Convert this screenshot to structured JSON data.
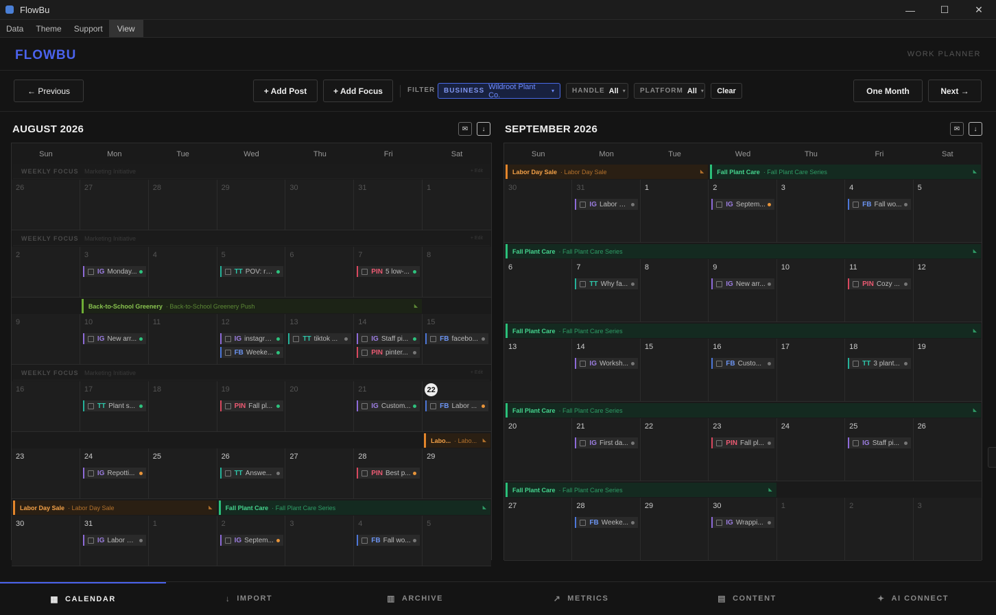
{
  "app": {
    "title": "FlowBu",
    "logo": "FLOWBU",
    "planner": "WORK PLANNER"
  },
  "window": {
    "minimize": "—",
    "maximize": "☐",
    "close": "✕"
  },
  "menu": [
    "Data",
    "Theme",
    "Support",
    "View"
  ],
  "toolbar": {
    "previous": "← Previous",
    "add_post": "+ Add Post",
    "add_focus": "+ Add Focus",
    "filter": "FILTER",
    "business_label": "BUSINESS",
    "business_value": "Wildroot Plant Co.",
    "handle_label": "HANDLE",
    "handle_value": "All",
    "platform_label": "PLATFORM",
    "platform_value": "All",
    "clear": "Clear",
    "one_month": "One Month",
    "next": "Next →"
  },
  "dow": [
    "Sun",
    "Mon",
    "Tue",
    "Wed",
    "Thu",
    "Fri",
    "Sat"
  ],
  "nav": [
    {
      "icon": "▦",
      "label": "CALENDAR"
    },
    {
      "icon": "↓",
      "label": "IMPORT"
    },
    {
      "icon": "▥",
      "label": "ARCHIVE"
    },
    {
      "icon": "↗",
      "label": "METRICS"
    },
    {
      "icon": "▤",
      "label": "CONTENT"
    },
    {
      "icon": "✦",
      "label": "AI CONNECT"
    }
  ],
  "colors": {
    "accent": "#4b63ee",
    "ig": "#8e6bd9",
    "tt": "#25b29a",
    "pin": "#d9485f",
    "fb": "#4d77d9"
  },
  "months": [
    {
      "title": "AUGUST 2026",
      "weeks": [
        {
          "focus": {
            "label": "WEEKLY FOCUS",
            "sub": "Marketing Initiative",
            "edit": "+ Edit"
          },
          "days": [
            {
              "n": "26",
              "out": true
            },
            {
              "n": "27",
              "out": true
            },
            {
              "n": "28",
              "out": true
            },
            {
              "n": "29",
              "out": true
            },
            {
              "n": "30",
              "out": true
            },
            {
              "n": "31",
              "out": true
            },
            {
              "n": "1",
              "out": true
            }
          ]
        },
        {
          "focus": {
            "label": "WEEKLY FOCUS",
            "sub": "Marketing Initiative",
            "edit": "+ Edit"
          },
          "days": [
            {
              "n": "2",
              "out": true
            },
            {
              "n": "3",
              "out": true,
              "posts": [
                {
                  "p": "IG",
                  "t": "Monday...",
                  "d": "#2ec27e"
                }
              ]
            },
            {
              "n": "4",
              "out": true
            },
            {
              "n": "5",
              "out": true,
              "posts": [
                {
                  "p": "TT",
                  "t": "POV: re...",
                  "d": "#2ec27e"
                }
              ]
            },
            {
              "n": "6",
              "out": true
            },
            {
              "n": "7",
              "out": true,
              "posts": [
                {
                  "p": "PIN",
                  "t": "5 low-...",
                  "d": "#2ec27e"
                }
              ]
            },
            {
              "n": "8",
              "out": true
            }
          ]
        },
        {
          "events": [
            {
              "s": 1,
              "e": 6,
              "c": "L",
              "n": "Back-to-School Greenery",
              "sub": "· Back-to-School Greenery Push"
            }
          ],
          "days": [
            {
              "n": "9",
              "out": true
            },
            {
              "n": "10",
              "out": true,
              "posts": [
                {
                  "p": "IG",
                  "t": "New arr...",
                  "d": "#2ec27e"
                }
              ]
            },
            {
              "n": "11",
              "out": true
            },
            {
              "n": "12",
              "out": true,
              "posts": [
                {
                  "p": "IG",
                  "t": "instagra...",
                  "d": "#2ec27e"
                },
                {
                  "p": "FB",
                  "t": "Weeke...",
                  "d": "#2ec27e"
                }
              ]
            },
            {
              "n": "13",
              "out": true,
              "posts": [
                {
                  "p": "TT",
                  "t": "tiktok ...",
                  "d": "#777"
                }
              ]
            },
            {
              "n": "14",
              "out": true,
              "posts": [
                {
                  "p": "IG",
                  "t": "Staff pi...",
                  "d": "#2ec27e"
                },
                {
                  "p": "PIN",
                  "t": "pinter...",
                  "d": "#777"
                }
              ]
            },
            {
              "n": "15",
              "out": true,
              "posts": [
                {
                  "p": "FB",
                  "t": "facebo...",
                  "d": "#777"
                }
              ]
            }
          ]
        },
        {
          "focus": {
            "label": "WEEKLY FOCUS",
            "sub": "Marketing Initiative",
            "edit": "+ Edit"
          },
          "days": [
            {
              "n": "16",
              "out": true
            },
            {
              "n": "17",
              "out": true,
              "posts": [
                {
                  "p": "TT",
                  "t": "Plant s...",
                  "d": "#2ec27e"
                }
              ]
            },
            {
              "n": "18",
              "out": true
            },
            {
              "n": "19",
              "out": true,
              "posts": [
                {
                  "p": "PIN",
                  "t": "Fall pl...",
                  "d": "#2ec27e"
                }
              ]
            },
            {
              "n": "20",
              "out": true
            },
            {
              "n": "21",
              "out": true,
              "posts": [
                {
                  "p": "IG",
                  "t": "Custom...",
                  "d": "#2ec27e"
                }
              ]
            },
            {
              "n": "22",
              "today": true,
              "posts": [
                {
                  "p": "FB",
                  "t": "Labor ...",
                  "d": "#e8943a"
                }
              ]
            }
          ]
        },
        {
          "events": [
            {
              "s": 6,
              "e": 7,
              "c": "O",
              "n": "Labo...",
              "sub": "· Labo..."
            }
          ],
          "days": [
            {
              "n": "23"
            },
            {
              "n": "24",
              "posts": [
                {
                  "p": "IG",
                  "t": "Repotti...",
                  "d": "#e8943a"
                }
              ]
            },
            {
              "n": "25"
            },
            {
              "n": "26",
              "posts": [
                {
                  "p": "TT",
                  "t": "Answe...",
                  "d": "#777"
                }
              ]
            },
            {
              "n": "27"
            },
            {
              "n": "28",
              "posts": [
                {
                  "p": "PIN",
                  "t": "Best p...",
                  "d": "#e8943a"
                }
              ]
            },
            {
              "n": "29"
            }
          ]
        },
        {
          "events": [
            {
              "s": 0,
              "e": 3,
              "c": "O",
              "n": "Labor Day Sale",
              "sub": "· Labor Day Sale"
            },
            {
              "s": 3,
              "e": 7,
              "c": "G",
              "n": "Fall Plant Care",
              "sub": "· Fall Plant Care Series"
            }
          ],
          "days": [
            {
              "n": "30"
            },
            {
              "n": "31",
              "posts": [
                {
                  "p": "IG",
                  "t": "Labor D...",
                  "d": "#777"
                }
              ]
            },
            {
              "n": "1",
              "out": true
            },
            {
              "n": "2",
              "out": true,
              "posts": [
                {
                  "p": "IG",
                  "t": "Septem...",
                  "d": "#e8943a"
                }
              ]
            },
            {
              "n": "3",
              "out": true
            },
            {
              "n": "4",
              "out": true,
              "posts": [
                {
                  "p": "FB",
                  "t": "Fall wo...",
                  "d": "#777"
                }
              ]
            },
            {
              "n": "5",
              "out": true
            }
          ]
        }
      ]
    },
    {
      "title": "SEPTEMBER 2026",
      "weeks": [
        {
          "events": [
            {
              "s": 0,
              "e": 3,
              "c": "O",
              "n": "Labor Day Sale",
              "sub": "· Labor Day Sale"
            },
            {
              "s": 3,
              "e": 7,
              "c": "G",
              "n": "Fall Plant Care",
              "sub": "· Fall Plant Care Series"
            }
          ],
          "days": [
            {
              "n": "30",
              "out": true
            },
            {
              "n": "31",
              "out": true,
              "posts": [
                {
                  "p": "IG",
                  "t": "Labor D...",
                  "d": "#777"
                }
              ]
            },
            {
              "n": "1"
            },
            {
              "n": "2",
              "posts": [
                {
                  "p": "IG",
                  "t": "Septem...",
                  "d": "#e8943a"
                }
              ]
            },
            {
              "n": "3"
            },
            {
              "n": "4",
              "posts": [
                {
                  "p": "FB",
                  "t": "Fall wo...",
                  "d": "#777"
                }
              ]
            },
            {
              "n": "5"
            }
          ]
        },
        {
          "events": [
            {
              "s": 0,
              "e": 7,
              "c": "G",
              "n": "Fall Plant Care",
              "sub": "· Fall Plant Care Series"
            }
          ],
          "days": [
            {
              "n": "6"
            },
            {
              "n": "7",
              "posts": [
                {
                  "p": "TT",
                  "t": "Why fa...",
                  "d": "#777"
                }
              ]
            },
            {
              "n": "8"
            },
            {
              "n": "9",
              "posts": [
                {
                  "p": "IG",
                  "t": "New arr...",
                  "d": "#777"
                }
              ]
            },
            {
              "n": "10"
            },
            {
              "n": "11",
              "posts": [
                {
                  "p": "PIN",
                  "t": "Cozy ...",
                  "d": "#777"
                }
              ]
            },
            {
              "n": "12"
            }
          ]
        },
        {
          "events": [
            {
              "s": 0,
              "e": 7,
              "c": "G",
              "n": "Fall Plant Care",
              "sub": "· Fall Plant Care Series"
            }
          ],
          "days": [
            {
              "n": "13"
            },
            {
              "n": "14",
              "posts": [
                {
                  "p": "IG",
                  "t": "Worksh...",
                  "d": "#777"
                }
              ]
            },
            {
              "n": "15"
            },
            {
              "n": "16",
              "posts": [
                {
                  "p": "FB",
                  "t": "Custo...",
                  "d": "#777"
                }
              ]
            },
            {
              "n": "17"
            },
            {
              "n": "18",
              "posts": [
                {
                  "p": "TT",
                  "t": "3 plant...",
                  "d": "#777"
                }
              ]
            },
            {
              "n": "19"
            }
          ]
        },
        {
          "events": [
            {
              "s": 0,
              "e": 7,
              "c": "G",
              "n": "Fall Plant Care",
              "sub": "· Fall Plant Care Series"
            }
          ],
          "days": [
            {
              "n": "20"
            },
            {
              "n": "21",
              "posts": [
                {
                  "p": "IG",
                  "t": "First da...",
                  "d": "#777"
                }
              ]
            },
            {
              "n": "22"
            },
            {
              "n": "23",
              "posts": [
                {
                  "p": "PIN",
                  "t": "Fall pl...",
                  "d": "#777"
                }
              ]
            },
            {
              "n": "24"
            },
            {
              "n": "25",
              "posts": [
                {
                  "p": "IG",
                  "t": "Staff pi...",
                  "d": "#777"
                }
              ]
            },
            {
              "n": "26"
            }
          ]
        },
        {
          "events": [
            {
              "s": 0,
              "e": 4,
              "c": "G",
              "n": "Fall Plant Care",
              "sub": "· Fall Plant Care Series"
            }
          ],
          "days": [
            {
              "n": "27"
            },
            {
              "n": "28",
              "posts": [
                {
                  "p": "FB",
                  "t": "Weeke...",
                  "d": "#777"
                }
              ]
            },
            {
              "n": "29"
            },
            {
              "n": "30",
              "posts": [
                {
                  "p": "IG",
                  "t": "Wrappi...",
                  "d": "#777"
                }
              ]
            },
            {
              "n": "1",
              "out": true
            },
            {
              "n": "2",
              "out": true
            },
            {
              "n": "3",
              "out": true
            }
          ]
        }
      ]
    }
  ]
}
